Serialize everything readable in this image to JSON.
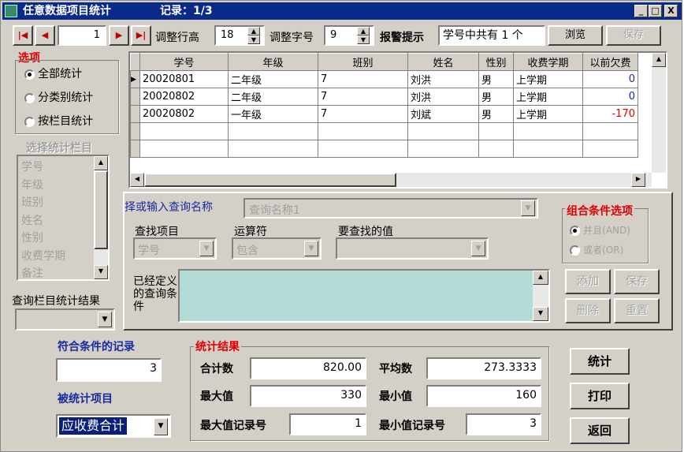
{
  "window": {
    "title": "任意数据项目统计",
    "record_label": "记录：1/3",
    "minimize": "_",
    "maximize": "□",
    "close": "X"
  },
  "toolbar": {
    "record_value": "1",
    "row_height_label": "调整行高",
    "row_height_value": "18",
    "font_size_label": "调整字号",
    "font_size_value": "9",
    "alert_label": "报警提示",
    "alert_text": "学号中共有 1 个",
    "browse_label": "浏览",
    "save_label": "保存"
  },
  "options": {
    "title": "选项",
    "radio1": "全部统计",
    "radio2": "分类别统计",
    "radio3": "按栏目统计",
    "selected": "全部统计",
    "column_list_title": "选择统计栏目",
    "column_items": [
      "学号",
      "年级",
      "班别",
      "姓名",
      "性别",
      "收费学期",
      "备注"
    ],
    "query_result_label": "查询栏目统计结果"
  },
  "grid": {
    "headers": [
      "学号",
      "年级",
      "班别",
      "姓名",
      "性别",
      "收费学期",
      "以前欠费"
    ],
    "rows": [
      [
        "20020801",
        "二年级",
        "7",
        "刘洪",
        "男",
        "上学期",
        "0"
      ],
      [
        "20020802",
        "二年级",
        "7",
        "刘洪",
        "男",
        "上学期",
        "0"
      ],
      [
        "20020802",
        "一年级",
        "7",
        "刘斌",
        "男",
        "上学期",
        "-170"
      ]
    ],
    "empty_rows": 2
  },
  "query": {
    "name_label": "择或输入查询名称",
    "name_placeholder": "查询名称1",
    "find_item_label": "查找项目",
    "find_item_value": "学号",
    "operator_label": "运算符",
    "operator_value": "包含",
    "value_label": "要查找的值",
    "defined_label": "已经定义的查询条件",
    "combo_title": "组合条件选项",
    "and_label": "并且(AND)",
    "or_label": "或者(OR)",
    "add_label": "添加",
    "save_label": "保存",
    "delete_label": "删除",
    "reset_label": "重置"
  },
  "matched": {
    "title": "符合条件的记录",
    "count": "3",
    "stat_item_title": "被统计项目",
    "stat_item_value": "应收费合计"
  },
  "stats": {
    "title": "统计结果",
    "total_label": "合计数",
    "total_value": "820.00",
    "avg_label": "平均数",
    "avg_value": "273.3333",
    "max_label": "最大值",
    "max_value": "330",
    "min_label": "最小值",
    "min_value": "160",
    "max_rec_label": "最大值记录号",
    "max_rec_value": "1",
    "min_rec_label": "最小值记录号",
    "min_rec_value": "3"
  },
  "actions": {
    "stat_label": "统计",
    "print_label": "打印",
    "back_label": "返回"
  },
  "colors": {
    "title_bar": "#0a2a8a",
    "negative": "#e00000",
    "positive": "#1a2aa0",
    "defined_area": "#b4dcd6"
  }
}
